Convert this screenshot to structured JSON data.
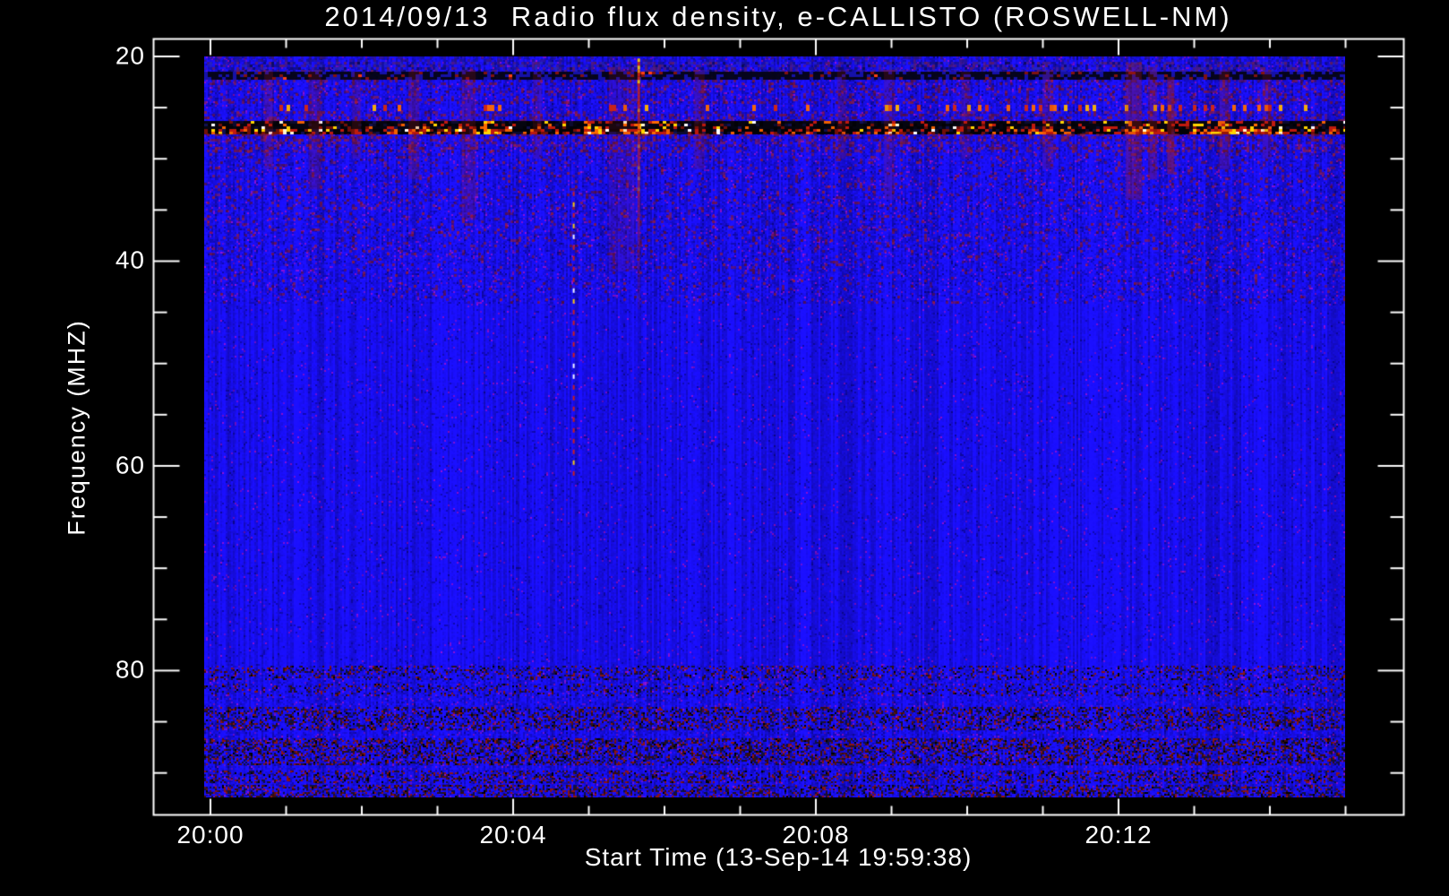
{
  "chart_data": {
    "type": "heatmap",
    "title": "2014/09/13  Radio flux density, e-CALLISTO (ROSWELL-NM)",
    "xlabel": "Start Time (13-Sep-14 19:59:38)",
    "ylabel": "Frequency (MHZ)",
    "legend": "none",
    "grid": "off",
    "axes": {
      "y": {
        "units": "MHz",
        "direction": "increasing-downward",
        "visible_range": [
          20,
          92.4
        ],
        "major": [
          {
            "label": "20",
            "value": 20
          },
          {
            "label": "40",
            "value": 40
          },
          {
            "label": "60",
            "value": 60
          },
          {
            "label": "80",
            "value": 80
          }
        ],
        "minor_values": [
          25,
          30,
          35,
          45,
          50,
          55,
          65,
          70,
          75,
          85,
          90
        ]
      },
      "x": {
        "units": "minutes after 20:00",
        "visible_range": [
          -0.1,
          15.0
        ],
        "major": [
          {
            "label": "20:00",
            "minute": 0
          },
          {
            "label": "20:04",
            "minute": 4
          },
          {
            "label": "20:08",
            "minute": 8
          },
          {
            "label": "20:12",
            "minute": 12
          }
        ],
        "minor_minutes": [
          1,
          2,
          3,
          5,
          6,
          7,
          9,
          10,
          11,
          13,
          14,
          15
        ]
      }
    },
    "colors": {
      "background": "#000000",
      "frame": "#ffffff",
      "text": "#ffffff",
      "base_blue": "#1e14ee",
      "rfi_red": "#c01a0e",
      "rfi_orange": "#ff6a00",
      "rfi_yellow": "#ffd400",
      "rfi_white": "#ffffff"
    },
    "bands": [
      {
        "name": "top-edge-mottle",
        "f0": 20.0,
        "f1": 20.55,
        "type": "mottle",
        "p": 0.3,
        "palette": [
          "#2a1470",
          "#141290",
          "#3a1670"
        ]
      },
      {
        "name": "purple-mix-21mhz",
        "f0": 20.55,
        "f1": 21.5,
        "type": "mottle",
        "p": 0.55,
        "palette": [
          "#4a1c6e",
          "#6e1d46",
          "#16127a",
          "#2a2aa8",
          "#0a0a40"
        ]
      },
      {
        "name": "dark-dashed-22mhz",
        "f0": 21.5,
        "f1": 22.3,
        "type": "dark-dash"
      },
      {
        "name": "red-streaky-23mhz",
        "f0": 22.3,
        "f1": 24.7,
        "type": "red-mottle",
        "p": 0.2
      },
      {
        "name": "dotted-25mhz",
        "f0": 24.75,
        "f1": 25.35,
        "type": "dot-row",
        "p": 0.14
      },
      {
        "name": "pre-rfi-mottle",
        "f0": 25.35,
        "f1": 26.3,
        "type": "red-mottle",
        "p": 0.28
      },
      {
        "name": "rfi-27mhz",
        "f0": 26.35,
        "f1": 27.6,
        "type": "rfi"
      },
      {
        "name": "post-rfi-red-28mhz",
        "f0": 27.6,
        "f1": 29.2,
        "type": "red-mottle",
        "p": 0.3
      },
      {
        "name": "upper-mottle",
        "f0": 29.2,
        "f1": 39.5,
        "type": "red-mottle",
        "p": 0.1
      },
      {
        "name": "mid-mottle-40mhz",
        "f0": 39.5,
        "f1": 44.0,
        "type": "red-mottle",
        "p": 0.06
      },
      {
        "name": "speckle-80mhz",
        "f0": 79.6,
        "f1": 80.9,
        "type": "speckle",
        "p": 0.22
      },
      {
        "name": "speckle-82mhz",
        "f0": 81.3,
        "f1": 82.5,
        "type": "speckle",
        "p": 0.18
      },
      {
        "name": "speckle-84mhz",
        "f0": 83.6,
        "f1": 85.8,
        "type": "speckle",
        "p": 0.34
      },
      {
        "name": "speckle-88mhz",
        "f0": 86.7,
        "f1": 89.3,
        "type": "speckle",
        "p": 0.4
      },
      {
        "name": "speckle-90mhz",
        "f0": 89.8,
        "f1": 91.0,
        "type": "speckle",
        "p": 0.3
      },
      {
        "name": "speckle-92mhz",
        "f0": 91.2,
        "f1": 92.4,
        "type": "speckle",
        "p": 0.38
      }
    ],
    "streaks": [
      {
        "type": "tint",
        "t": 0.77,
        "w": 10,
        "f0": 21.3,
        "f1": 31.0,
        "a": 0.22
      },
      {
        "type": "tint",
        "t": 1.38,
        "w": 14,
        "f0": 21.3,
        "f1": 33.0,
        "a": 0.2
      },
      {
        "type": "tint",
        "t": 1.93,
        "w": 10,
        "f0": 21.5,
        "f1": 30.0,
        "a": 0.18
      },
      {
        "type": "tint",
        "t": 2.69,
        "w": 12,
        "f0": 21.3,
        "f1": 32.0,
        "a": 0.22
      },
      {
        "type": "tint",
        "t": 3.41,
        "w": 16,
        "f0": 21.3,
        "f1": 36.0,
        "a": 0.2
      },
      {
        "type": "tint",
        "t": 4.32,
        "w": 10,
        "f0": 21.5,
        "f1": 30.0,
        "a": 0.18
      },
      {
        "type": "tint",
        "t": 5.44,
        "w": 30,
        "f0": 21.0,
        "f1": 41.0,
        "a": 0.13
      },
      {
        "type": "tint",
        "t": 6.46,
        "w": 12,
        "f0": 21.3,
        "f1": 31.0,
        "a": 0.2
      },
      {
        "type": "tint",
        "t": 8.34,
        "w": 10,
        "f0": 21.3,
        "f1": 30.0,
        "a": 0.2
      },
      {
        "type": "tint",
        "t": 8.97,
        "w": 12,
        "f0": 21.3,
        "f1": 34.0,
        "a": 0.18
      },
      {
        "type": "tint",
        "t": 9.98,
        "w": 10,
        "f0": 21.5,
        "f1": 30.0,
        "a": 0.18
      },
      {
        "type": "tint",
        "t": 11.07,
        "w": 12,
        "f0": 21.3,
        "f1": 31.0,
        "a": 0.2
      },
      {
        "type": "tint",
        "t": 12.2,
        "w": 18,
        "f0": 20.6,
        "f1": 34.0,
        "a": 0.3
      },
      {
        "type": "tint",
        "t": 12.45,
        "w": 10,
        "f0": 21.0,
        "f1": 32.0,
        "a": 0.28
      },
      {
        "type": "tint",
        "t": 12.69,
        "w": 8,
        "f0": 22.0,
        "f1": 31.5,
        "a": 0.45
      },
      {
        "type": "tint",
        "t": 13.4,
        "w": 12,
        "f0": 21.3,
        "f1": 31.0,
        "a": 0.22
      },
      {
        "type": "tint",
        "t": 13.96,
        "w": 10,
        "f0": 21.3,
        "f1": 30.0,
        "a": 0.2
      },
      {
        "type": "bright",
        "t": 5.66,
        "w": 3,
        "f0": 20.2,
        "f1": 44.5
      },
      {
        "type": "dashed",
        "t": 4.8,
        "w": 2,
        "f0": 33.2,
        "f1": 61.2
      }
    ],
    "rfi_hotspots": [
      [
        0.9,
        1.12
      ],
      [
        2.6,
        2.85
      ],
      [
        3.6,
        3.82
      ],
      [
        4.9,
        5.15
      ],
      [
        5.38,
        5.9
      ],
      [
        8.9,
        9.12
      ],
      [
        10.9,
        11.1
      ],
      [
        12.05,
        12.62
      ],
      [
        12.95,
        14.15
      ]
    ]
  }
}
